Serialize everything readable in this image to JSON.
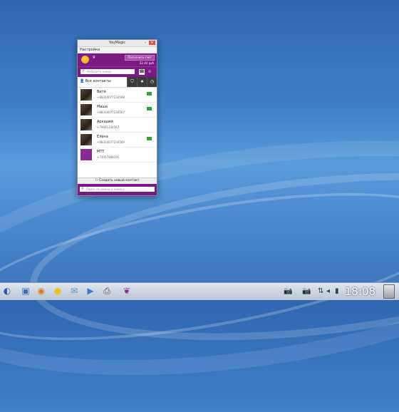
{
  "window": {
    "title": "YouMagic",
    "menu": "Настройки",
    "user": {
      "name": "Я",
      "topup_label": "Пополнить счет",
      "balance": "22.44 руб"
    },
    "dial_placeholder": "Наберите номер",
    "tabs": {
      "all_contacts": "Все контакты"
    },
    "contacts": [
      {
        "name": "Витя",
        "phone": "+88314077234568",
        "has_mail": true
      },
      {
        "name": "Маша",
        "phone": "+88314077234567",
        "has_mail": true
      },
      {
        "name": "Аркадий",
        "phone": "+79001234567",
        "has_mail": false
      },
      {
        "name": "Елена",
        "phone": "+88314077234569",
        "has_mail": true
      },
      {
        "name": "МТТ",
        "phone": "+74957898191",
        "has_mail": false
      }
    ],
    "create_contact": "Создать новый контакт",
    "bottom_search_placeholder": "Поиск по имени и номеру"
  },
  "taskbar": {
    "clock": "18:08"
  }
}
